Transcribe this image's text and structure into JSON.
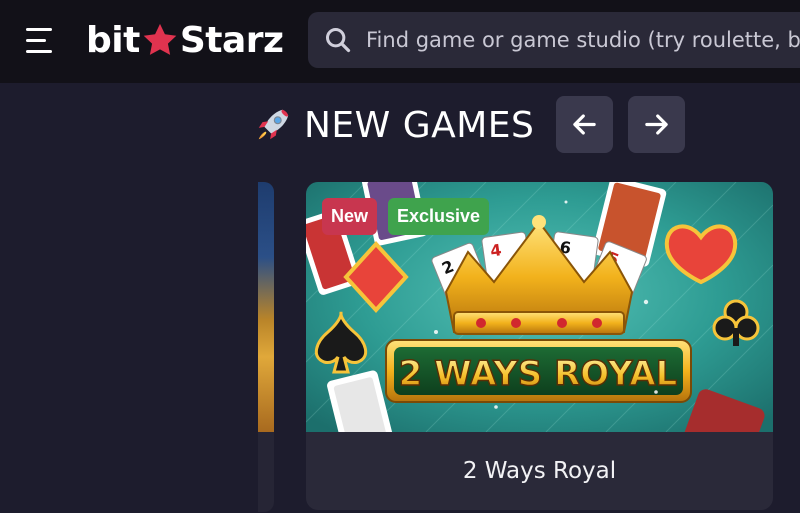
{
  "header": {
    "logo_part1": "bit",
    "logo_part2": "Starz",
    "search": {
      "placeholder": "Find game or game studio (try roulette, bo"
    }
  },
  "section": {
    "title": "NEW GAMES",
    "icon": "rocket-icon"
  },
  "game_card": {
    "badges": [
      "New",
      "Exclusive"
    ],
    "art_text": "2 WAYS ROYAL",
    "name": "2 Ways Royal"
  },
  "colors": {
    "header_bg": "#121118",
    "page_bg": "#1d1c2d",
    "accent_star": "#e0334f",
    "badge_new": "#c8364f",
    "badge_exclusive": "#3fa34d",
    "card_bg": "#2a2939"
  }
}
